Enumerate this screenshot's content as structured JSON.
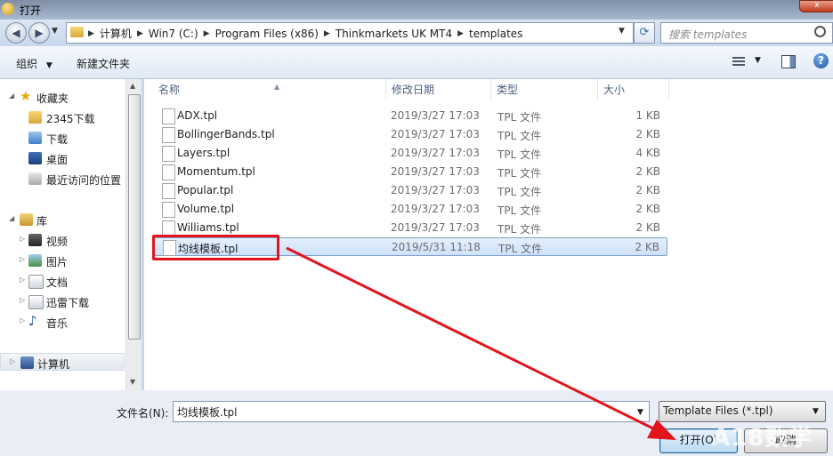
{
  "window": {
    "title": "打开",
    "close": "x"
  },
  "nav": {
    "breadcrumbs": [
      "计算机",
      "Win7 (C:)",
      "Program Files (x86)",
      "Thinkmarkets UK MT4",
      "templates"
    ],
    "search_placeholder": "搜索 templates"
  },
  "toolbar": {
    "organize": "组织",
    "new_folder": "新建文件夹"
  },
  "sidebar": {
    "favorites": {
      "label": "收藏夹",
      "items": [
        "2345下载",
        "下载",
        "桌面",
        "最近访问的位置"
      ]
    },
    "libraries": {
      "label": "库",
      "items": [
        "视频",
        "图片",
        "文档",
        "迅雷下载",
        "音乐"
      ]
    },
    "computer": {
      "label": "计算机"
    }
  },
  "columns": {
    "name": "名称",
    "date": "修改日期",
    "type": "类型",
    "size": "大小"
  },
  "files": [
    {
      "name": "ADX.tpl",
      "date": "2019/3/27 17:03",
      "type": "TPL 文件",
      "size": "1 KB"
    },
    {
      "name": "BollingerBands.tpl",
      "date": "2019/3/27 17:03",
      "type": "TPL 文件",
      "size": "2 KB"
    },
    {
      "name": "Layers.tpl",
      "date": "2019/3/27 17:03",
      "type": "TPL 文件",
      "size": "4 KB"
    },
    {
      "name": "Momentum.tpl",
      "date": "2019/3/27 17:03",
      "type": "TPL 文件",
      "size": "2 KB"
    },
    {
      "name": "Popular.tpl",
      "date": "2019/3/27 17:03",
      "type": "TPL 文件",
      "size": "2 KB"
    },
    {
      "name": "Volume.tpl",
      "date": "2019/3/27 17:03",
      "type": "TPL 文件",
      "size": "2 KB"
    },
    {
      "name": "Williams.tpl",
      "date": "2019/3/27 17:03",
      "type": "TPL 文件",
      "size": "2 KB"
    },
    {
      "name": "均线模板.tpl",
      "date": "2019/5/31 11:18",
      "type": "TPL 文件",
      "size": "2 KB"
    }
  ],
  "selected_file_index": 7,
  "bottom": {
    "filename_label": "文件名(N):",
    "filename_value": "均线模板.tpl",
    "filter_value": "Template Files (*.tpl)",
    "open_button": "打开(O)",
    "cancel_button": "取消"
  },
  "watermark": "A18数学",
  "colors": {
    "highlight": "#e3141c",
    "selection": "#cfe2f9"
  }
}
